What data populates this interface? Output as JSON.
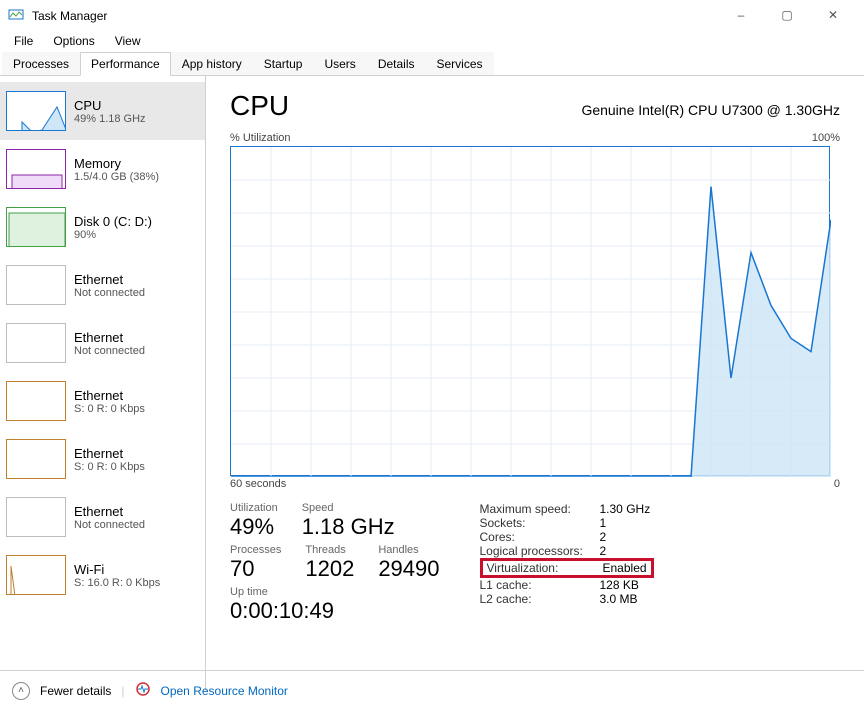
{
  "window": {
    "title": "Task Manager"
  },
  "window_buttons": {
    "min": "–",
    "max": "▢",
    "close": "✕"
  },
  "menubar": [
    "File",
    "Options",
    "View"
  ],
  "tabs": [
    "Processes",
    "Performance",
    "App history",
    "Startup",
    "Users",
    "Details",
    "Services"
  ],
  "active_tab": 1,
  "sidebar": [
    {
      "name": "CPU",
      "sub": "49% 1.18 GHz",
      "color": "#1976d2",
      "thumb": "cpu"
    },
    {
      "name": "Memory",
      "sub": "1.5/4.0 GB (38%)",
      "color": "#8e24aa",
      "thumb": "memory"
    },
    {
      "name": "Disk 0 (C: D:)",
      "sub": "90%",
      "color": "#43a047",
      "thumb": "disk"
    },
    {
      "name": "Ethernet",
      "sub": "Not connected",
      "color": "#bdbdbd",
      "thumb": "empty"
    },
    {
      "name": "Ethernet",
      "sub": "Not connected",
      "color": "#bdbdbd",
      "thumb": "empty"
    },
    {
      "name": "Ethernet",
      "sub": "S: 0 R: 0 Kbps",
      "color": "#bf7f2f",
      "thumb": "flat"
    },
    {
      "name": "Ethernet",
      "sub": "S: 0 R: 0 Kbps",
      "color": "#bf7f2f",
      "thumb": "flat"
    },
    {
      "name": "Ethernet",
      "sub": "Not connected",
      "color": "#bdbdbd",
      "thumb": "empty"
    },
    {
      "name": "Wi-Fi",
      "sub": "S: 16.0 R: 0 Kbps",
      "color": "#bf7f2f",
      "thumb": "wifi"
    }
  ],
  "detail": {
    "title": "CPU",
    "model": "Genuine Intel(R) CPU U7300 @ 1.30GHz",
    "chart_top_left": "% Utilization",
    "chart_top_right": "100%",
    "chart_bottom_left": "60 seconds",
    "chart_bottom_right": "0",
    "stats": {
      "utilization": {
        "label": "Utilization",
        "value": "49%"
      },
      "speed": {
        "label": "Speed",
        "value": "1.18 GHz"
      },
      "processes": {
        "label": "Processes",
        "value": "70"
      },
      "threads": {
        "label": "Threads",
        "value": "1202"
      },
      "handles": {
        "label": "Handles",
        "value": "29490"
      },
      "uptime": {
        "label": "Up time",
        "value": "0:00:10:49"
      }
    },
    "right_stats": [
      {
        "label": "Maximum speed:",
        "value": "1.30 GHz"
      },
      {
        "label": "Sockets:",
        "value": "1"
      },
      {
        "label": "Cores:",
        "value": "2"
      },
      {
        "label": "Logical processors:",
        "value": "2"
      },
      {
        "label": "Virtualization:",
        "value": "Enabled",
        "highlight": true
      },
      {
        "label": "L1 cache:",
        "value": "128 KB"
      },
      {
        "label": "L2 cache:",
        "value": "3.0 MB"
      }
    ]
  },
  "footer": {
    "fewer": "Fewer details",
    "open_rm": "Open Resource Monitor"
  },
  "chart_data": {
    "type": "line",
    "title": "% Utilization",
    "xlabel": "seconds ago",
    "ylabel": "% Utilization",
    "xlim": [
      60,
      0
    ],
    "ylim": [
      0,
      100
    ],
    "x": [
      60,
      58,
      56,
      54,
      52,
      50,
      48,
      46,
      44,
      42,
      40,
      38,
      36,
      34,
      32,
      30,
      28,
      26,
      24,
      22,
      20,
      18,
      16,
      14,
      12,
      10,
      8,
      6,
      4,
      2,
      0
    ],
    "values": [
      0,
      0,
      0,
      0,
      0,
      0,
      0,
      0,
      0,
      0,
      0,
      0,
      0,
      0,
      0,
      0,
      0,
      0,
      0,
      0,
      0,
      0,
      0,
      0,
      88,
      30,
      68,
      52,
      42,
      38,
      78
    ]
  }
}
